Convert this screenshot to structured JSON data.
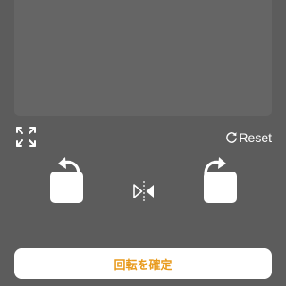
{
  "editor": {
    "reset_label": "Reset",
    "confirm_label": "回転を確定"
  },
  "icons": {
    "expand": "expand-icon",
    "reset": "reset-icon",
    "rotate_left": "rotate-left-icon",
    "rotate_right": "rotate-right-icon",
    "flip": "flip-horizontal-icon"
  },
  "colors": {
    "background": "#5c5c5c",
    "preview": "#656565",
    "accent": "#e89a1c",
    "icon": "#ffffff"
  }
}
